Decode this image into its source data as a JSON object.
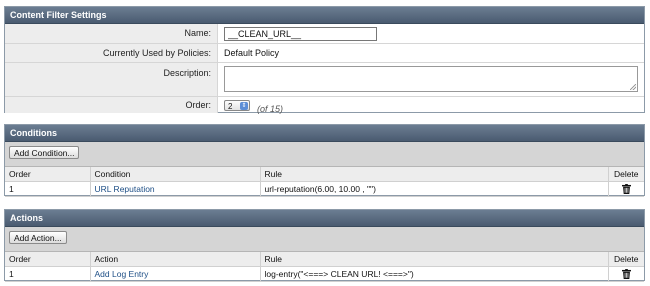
{
  "settings": {
    "title": "Content Filter Settings",
    "name_label": "Name:",
    "name_value": "__CLEAN_URL__",
    "used_label": "Currently Used by Policies:",
    "used_value": "Default Policy",
    "desc_label": "Description:",
    "desc_value": "",
    "order_label": "Order:",
    "order_value": "2",
    "order_total": "(of 15)"
  },
  "conditions": {
    "title": "Conditions",
    "add_label": "Add Condition...",
    "columns": [
      "Order",
      "Condition",
      "Rule",
      "Delete"
    ],
    "rows": [
      {
        "order": "1",
        "name": "URL Reputation",
        "rule": "url-reputation(6.00, 10.00 , \"\")"
      }
    ]
  },
  "actions": {
    "title": "Actions",
    "add_label": "Add Action...",
    "columns": [
      "Order",
      "Action",
      "Rule",
      "Delete"
    ],
    "rows": [
      {
        "order": "1",
        "name": "Add Log Entry",
        "rule": "log-entry(\"<===> CLEAN URL! <===>\")"
      }
    ]
  },
  "icons": {
    "delete": "trash-icon",
    "stepper": "up-down-arrows-icon",
    "resize": "resize-grip-icon"
  },
  "colors": {
    "header": "#4f6075",
    "link": "#1e4f86"
  }
}
